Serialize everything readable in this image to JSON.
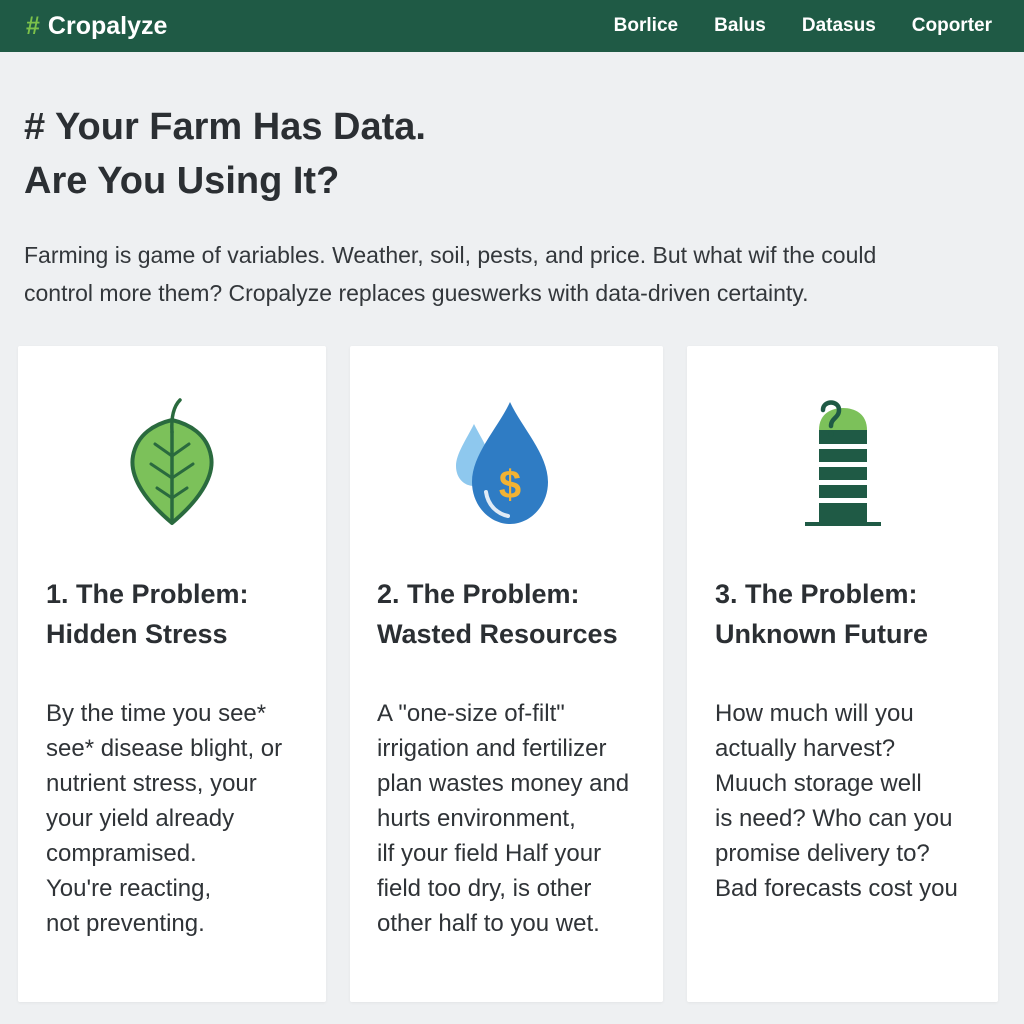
{
  "brand": {
    "hash": "#",
    "name": "Cropalyze"
  },
  "nav": [
    "Borlice",
    "Balus",
    "Datasus",
    "Coporter"
  ],
  "hero": {
    "title_line1": "# Your Farm Has Data.",
    "title_line2": "Are You Using It?",
    "intro_line1": "Farming is game of variables. Weather, soil, pests, and price. But what wif the could",
    "intro_line2": "control more them? Cropalyze replaces gueswerks with data-driven certainty."
  },
  "cards": [
    {
      "icon": "leaf-icon",
      "title_line1": "1. The Problem:",
      "title_line2": "Hidden Stress",
      "body": "By the time you see*\nsee* disease  blight, or\nnutrient stress, your\nyour yield already\ncompramised.\nYou're reacting,\nnot preventing."
    },
    {
      "icon": "water-drop-dollar-icon",
      "title_line1": "2. The Problem:",
      "title_line2": "Wasted Resources",
      "body": "  A \"one-size of-filt\"\nirrigation and fertilizer\nplan wastes money and\nhurts environment,\nilf your field Half your\nfield too dry, is other\nother half to you wet."
    },
    {
      "icon": "storage-silo-question-icon",
      "title_line1": "3. The Problem:",
      "title_line2": "Unknown Future",
      "body": "How much will you\nactually harvest?\nMuuch storage well\nis need? Who can you\npromise delivery to?\nBad forecasts cost you"
    }
  ],
  "colors": {
    "header": "#1f5a45",
    "accent_green": "#7cc14a",
    "leaf_fill": "#7cc15a",
    "leaf_stroke": "#2a6a3e",
    "drop_blue": "#2f7cc4",
    "drop_light": "#8ec8ee",
    "dollar": "#f2b233",
    "silo_dark": "#1f5a45"
  }
}
